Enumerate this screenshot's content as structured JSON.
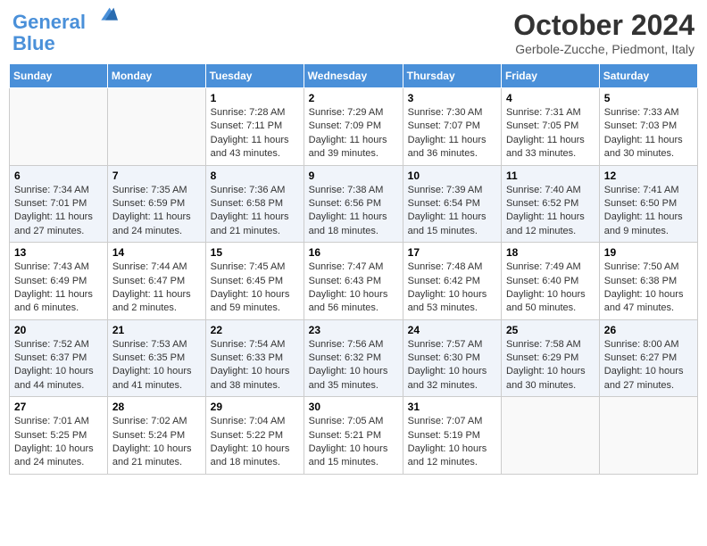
{
  "header": {
    "logo_line1": "General",
    "logo_line2": "Blue",
    "month": "October 2024",
    "location": "Gerbole-Zucche, Piedmont, Italy"
  },
  "days_of_week": [
    "Sunday",
    "Monday",
    "Tuesday",
    "Wednesday",
    "Thursday",
    "Friday",
    "Saturday"
  ],
  "weeks": [
    [
      {
        "day": "",
        "info": ""
      },
      {
        "day": "",
        "info": ""
      },
      {
        "day": "1",
        "info": "Sunrise: 7:28 AM\nSunset: 7:11 PM\nDaylight: 11 hours and 43 minutes."
      },
      {
        "day": "2",
        "info": "Sunrise: 7:29 AM\nSunset: 7:09 PM\nDaylight: 11 hours and 39 minutes."
      },
      {
        "day": "3",
        "info": "Sunrise: 7:30 AM\nSunset: 7:07 PM\nDaylight: 11 hours and 36 minutes."
      },
      {
        "day": "4",
        "info": "Sunrise: 7:31 AM\nSunset: 7:05 PM\nDaylight: 11 hours and 33 minutes."
      },
      {
        "day": "5",
        "info": "Sunrise: 7:33 AM\nSunset: 7:03 PM\nDaylight: 11 hours and 30 minutes."
      }
    ],
    [
      {
        "day": "6",
        "info": "Sunrise: 7:34 AM\nSunset: 7:01 PM\nDaylight: 11 hours and 27 minutes."
      },
      {
        "day": "7",
        "info": "Sunrise: 7:35 AM\nSunset: 6:59 PM\nDaylight: 11 hours and 24 minutes."
      },
      {
        "day": "8",
        "info": "Sunrise: 7:36 AM\nSunset: 6:58 PM\nDaylight: 11 hours and 21 minutes."
      },
      {
        "day": "9",
        "info": "Sunrise: 7:38 AM\nSunset: 6:56 PM\nDaylight: 11 hours and 18 minutes."
      },
      {
        "day": "10",
        "info": "Sunrise: 7:39 AM\nSunset: 6:54 PM\nDaylight: 11 hours and 15 minutes."
      },
      {
        "day": "11",
        "info": "Sunrise: 7:40 AM\nSunset: 6:52 PM\nDaylight: 11 hours and 12 minutes."
      },
      {
        "day": "12",
        "info": "Sunrise: 7:41 AM\nSunset: 6:50 PM\nDaylight: 11 hours and 9 minutes."
      }
    ],
    [
      {
        "day": "13",
        "info": "Sunrise: 7:43 AM\nSunset: 6:49 PM\nDaylight: 11 hours and 6 minutes."
      },
      {
        "day": "14",
        "info": "Sunrise: 7:44 AM\nSunset: 6:47 PM\nDaylight: 11 hours and 2 minutes."
      },
      {
        "day": "15",
        "info": "Sunrise: 7:45 AM\nSunset: 6:45 PM\nDaylight: 10 hours and 59 minutes."
      },
      {
        "day": "16",
        "info": "Sunrise: 7:47 AM\nSunset: 6:43 PM\nDaylight: 10 hours and 56 minutes."
      },
      {
        "day": "17",
        "info": "Sunrise: 7:48 AM\nSunset: 6:42 PM\nDaylight: 10 hours and 53 minutes."
      },
      {
        "day": "18",
        "info": "Sunrise: 7:49 AM\nSunset: 6:40 PM\nDaylight: 10 hours and 50 minutes."
      },
      {
        "day": "19",
        "info": "Sunrise: 7:50 AM\nSunset: 6:38 PM\nDaylight: 10 hours and 47 minutes."
      }
    ],
    [
      {
        "day": "20",
        "info": "Sunrise: 7:52 AM\nSunset: 6:37 PM\nDaylight: 10 hours and 44 minutes."
      },
      {
        "day": "21",
        "info": "Sunrise: 7:53 AM\nSunset: 6:35 PM\nDaylight: 10 hours and 41 minutes."
      },
      {
        "day": "22",
        "info": "Sunrise: 7:54 AM\nSunset: 6:33 PM\nDaylight: 10 hours and 38 minutes."
      },
      {
        "day": "23",
        "info": "Sunrise: 7:56 AM\nSunset: 6:32 PM\nDaylight: 10 hours and 35 minutes."
      },
      {
        "day": "24",
        "info": "Sunrise: 7:57 AM\nSunset: 6:30 PM\nDaylight: 10 hours and 32 minutes."
      },
      {
        "day": "25",
        "info": "Sunrise: 7:58 AM\nSunset: 6:29 PM\nDaylight: 10 hours and 30 minutes."
      },
      {
        "day": "26",
        "info": "Sunrise: 8:00 AM\nSunset: 6:27 PM\nDaylight: 10 hours and 27 minutes."
      }
    ],
    [
      {
        "day": "27",
        "info": "Sunrise: 7:01 AM\nSunset: 5:25 PM\nDaylight: 10 hours and 24 minutes."
      },
      {
        "day": "28",
        "info": "Sunrise: 7:02 AM\nSunset: 5:24 PM\nDaylight: 10 hours and 21 minutes."
      },
      {
        "day": "29",
        "info": "Sunrise: 7:04 AM\nSunset: 5:22 PM\nDaylight: 10 hours and 18 minutes."
      },
      {
        "day": "30",
        "info": "Sunrise: 7:05 AM\nSunset: 5:21 PM\nDaylight: 10 hours and 15 minutes."
      },
      {
        "day": "31",
        "info": "Sunrise: 7:07 AM\nSunset: 5:19 PM\nDaylight: 10 hours and 12 minutes."
      },
      {
        "day": "",
        "info": ""
      },
      {
        "day": "",
        "info": ""
      }
    ]
  ]
}
